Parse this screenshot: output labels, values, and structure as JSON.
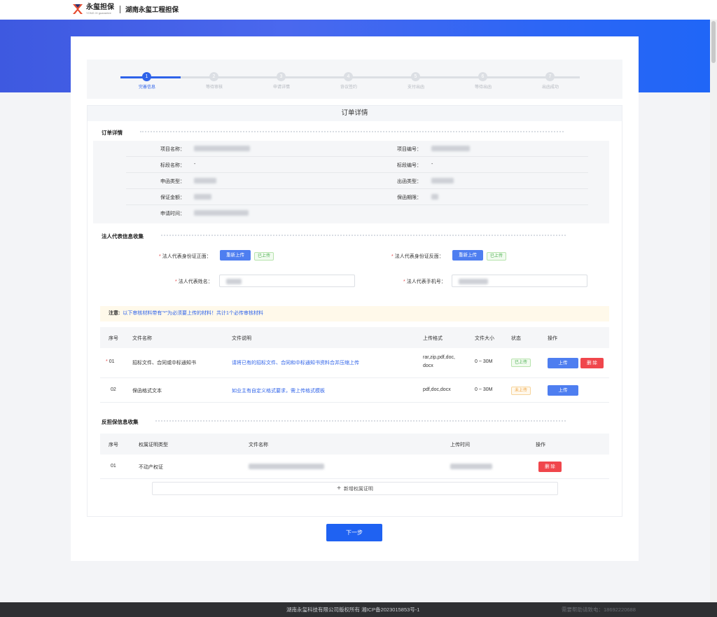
{
  "header": {
    "logo_cn": "永玺担保",
    "logo_en": "YONG XI guarantee",
    "company": "湖南永玺工程担保"
  },
  "steps": [
    {
      "num": "1",
      "label": "完善信息",
      "active": true
    },
    {
      "num": "2",
      "label": "等待审核",
      "active": false
    },
    {
      "num": "3",
      "label": "申请详情",
      "active": false
    },
    {
      "num": "4",
      "label": "协议签约",
      "active": false
    },
    {
      "num": "5",
      "label": "支付出函",
      "active": false
    },
    {
      "num": "6",
      "label": "等待出函",
      "active": false
    },
    {
      "num": "7",
      "label": "出函成功",
      "active": false
    }
  ],
  "panel_title": "订单详情",
  "order": {
    "section_title": "订单详情",
    "project_name_label": "项目名称：",
    "project_no_label": "项目编号：",
    "section_name_label": "标段名称：",
    "section_name_value": "-",
    "section_no_label": "标段编号：",
    "section_no_value": "-",
    "apply_type_label": "申函类型：",
    "issue_type_label": "出函类型：",
    "amount_label": "保证金额：",
    "period_label": "保函期限：",
    "apply_time_label": "申请时间："
  },
  "legal": {
    "section_title": "法人代表信息收集",
    "id_front_label": "法人代表身份证正面：",
    "id_back_label": "法人代表身份证反面：",
    "reupload": "重新上传",
    "uploaded": "已上传",
    "name_label": "法人代表姓名：",
    "phone_label": "法人代表手机号："
  },
  "notice": {
    "bold": "注意:",
    "text": "以下审核材料带有\"*\"为必须要上传的材料！共计1个必传审核材料"
  },
  "files_table": {
    "headers": [
      "序号",
      "文件名称",
      "文件说明",
      "上传格式",
      "文件大小",
      "状态",
      "操作"
    ],
    "rows": [
      {
        "no": "01",
        "required": true,
        "name": "招标文件、合同或中标通知书",
        "desc": "请将已有的招标文件、合同和中标通知书资料合并压缩上传",
        "format_line1": "rar,zip,pdf,doc,",
        "format_line2": "docx",
        "size": "0 ~ 30M",
        "status": "已上传",
        "upload": "上传",
        "delete": "删 除"
      },
      {
        "no": "02",
        "required": false,
        "name": "保函格式文本",
        "desc": "如业主有自定义格式要求，需上传格式模板",
        "format_line1": "pdf,doc,docx",
        "format_line2": "",
        "size": "0 ~ 30M",
        "status": "未上传",
        "upload": "上传",
        "delete": ""
      }
    ]
  },
  "counter": {
    "section_title": "反担保信息收集",
    "headers": [
      "序号",
      "权属证明类型",
      "文件名称",
      "上传时间",
      "操作"
    ],
    "rows": [
      {
        "no": "01",
        "type": "不动产权证",
        "delete": "删 除"
      }
    ],
    "add_label": "新增权属证明"
  },
  "next_button": "下一步",
  "footer": {
    "copyright": "湖南永玺科技有限公司版权所有 湘ICP备2023015853号-1",
    "hotline": "需要帮助请致电：18692220688"
  },
  "colors": {
    "primary": "#1f62f2",
    "active_step": "#2f63e9",
    "danger": "#f0464c",
    "success": "#4caf50",
    "warning": "#f0a13a"
  }
}
